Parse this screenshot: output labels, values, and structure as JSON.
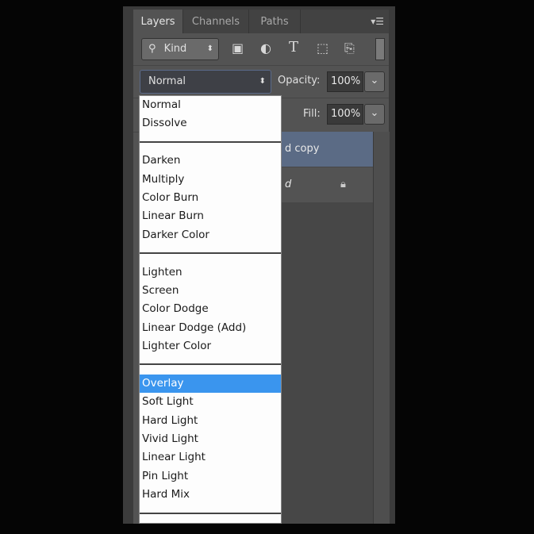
{
  "tabs": [
    {
      "label": "Layers",
      "active": true
    },
    {
      "label": "Channels"
    },
    {
      "label": "Paths"
    }
  ],
  "filter": {
    "label": "Kind",
    "icons": [
      "image-filter-icon",
      "adjustment-filter-icon",
      "type-filter-icon",
      "shape-filter-icon",
      "smart-object-filter-icon"
    ]
  },
  "blend_mode": {
    "value": "Normal"
  },
  "opacity": {
    "label": "Opacity:",
    "value": "100%"
  },
  "fill": {
    "label": "Fill:",
    "value": "100%"
  },
  "layers": [
    {
      "name": "d copy",
      "selected": true
    },
    {
      "name": "d",
      "locked": true
    }
  ],
  "menu": {
    "groups": [
      [
        "Normal",
        "Dissolve"
      ],
      [
        "Darken",
        "Multiply",
        "Color Burn",
        "Linear Burn",
        "Darker Color"
      ],
      [
        "Lighten",
        "Screen",
        "Color Dodge",
        "Linear Dodge (Add)",
        "Lighter Color"
      ],
      [
        "Overlay",
        "Soft Light",
        "Hard Light",
        "Vivid Light",
        "Linear Light",
        "Pin Light",
        "Hard Mix"
      ]
    ],
    "selected": "Overlay"
  },
  "colors": {
    "highlight": "#3a95ee",
    "panel": "#535353"
  }
}
